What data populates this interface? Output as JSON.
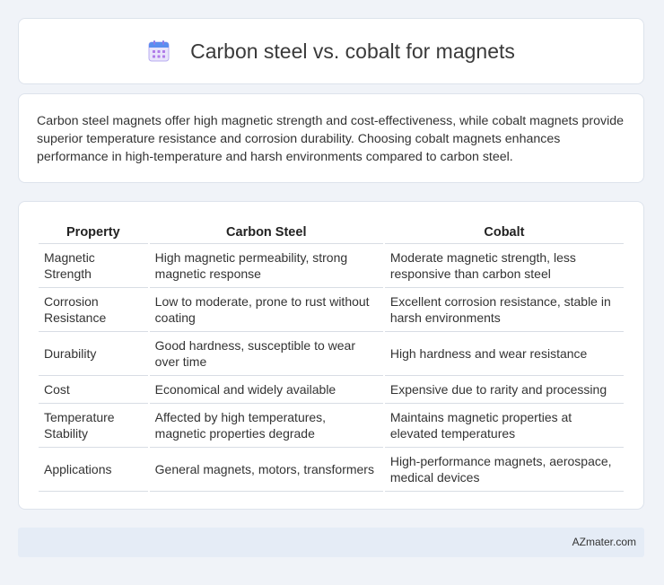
{
  "header": {
    "title": "Carbon steel vs. cobalt for magnets",
    "icon": "calendar-icon"
  },
  "intro": {
    "text": "Carbon steel magnets offer high magnetic strength and cost-effectiveness, while cobalt magnets provide superior temperature resistance and corrosion durability. Choosing cobalt magnets enhances performance in high-temperature and harsh environments compared to carbon steel."
  },
  "table": {
    "headers": [
      "Property",
      "Carbon Steel",
      "Cobalt"
    ],
    "rows": [
      [
        "Magnetic Strength",
        "High magnetic permeability, strong magnetic response",
        "Moderate magnetic strength, less responsive than carbon steel"
      ],
      [
        "Corrosion Resistance",
        "Low to moderate, prone to rust without coating",
        "Excellent corrosion resistance, stable in harsh environments"
      ],
      [
        "Durability",
        "Good hardness, susceptible to wear over time",
        "High hardness and wear resistance"
      ],
      [
        "Cost",
        "Economical and widely available",
        "Expensive due to rarity and processing"
      ],
      [
        "Temperature Stability",
        "Affected by high temperatures, magnetic properties degrade",
        "Maintains magnetic properties at elevated temperatures"
      ],
      [
        "Applications",
        "General magnets, motors, transformers",
        "High-performance magnets, aerospace, medical devices"
      ]
    ]
  },
  "footer": {
    "brand": "AZmater.com"
  }
}
